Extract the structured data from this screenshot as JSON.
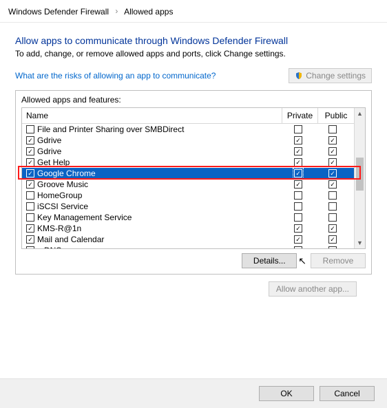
{
  "breadcrumb": {
    "parent": "Windows Defender Firewall",
    "current": "Allowed apps"
  },
  "heading": "Allow apps to communicate through Windows Defender Firewall",
  "subheading": "To add, change, or remove allowed apps and ports, click Change settings.",
  "risk_link": "What are the risks of allowing an app to communicate?",
  "change_settings_button": "Change settings",
  "fieldset_label": "Allowed apps and features:",
  "columns": {
    "name": "Name",
    "private": "Private",
    "public": "Public"
  },
  "rows": [
    {
      "name": "File and Printer Sharing over SMBDirect",
      "enabled": false,
      "private": false,
      "public": false,
      "selected": false
    },
    {
      "name": "Gdrive",
      "enabled": true,
      "private": true,
      "public": true,
      "selected": false
    },
    {
      "name": "Gdrive",
      "enabled": true,
      "private": true,
      "public": true,
      "selected": false
    },
    {
      "name": "Get Help",
      "enabled": true,
      "private": true,
      "public": true,
      "selected": false
    },
    {
      "name": "Google Chrome",
      "enabled": true,
      "private": true,
      "public": true,
      "selected": true
    },
    {
      "name": "Groove Music",
      "enabled": true,
      "private": true,
      "public": true,
      "selected": false
    },
    {
      "name": "HomeGroup",
      "enabled": false,
      "private": false,
      "public": false,
      "selected": false
    },
    {
      "name": "iSCSI Service",
      "enabled": false,
      "private": false,
      "public": false,
      "selected": false
    },
    {
      "name": "Key Management Service",
      "enabled": false,
      "private": false,
      "public": false,
      "selected": false
    },
    {
      "name": "KMS-R@1n",
      "enabled": true,
      "private": true,
      "public": true,
      "selected": false
    },
    {
      "name": "Mail and Calendar",
      "enabled": true,
      "private": true,
      "public": true,
      "selected": false
    },
    {
      "name": "mDNS",
      "enabled": true,
      "private": true,
      "public": true,
      "selected": false
    }
  ],
  "buttons": {
    "details": "Details...",
    "remove": "Remove",
    "allow_another": "Allow another app...",
    "ok": "OK",
    "cancel": "Cancel"
  }
}
